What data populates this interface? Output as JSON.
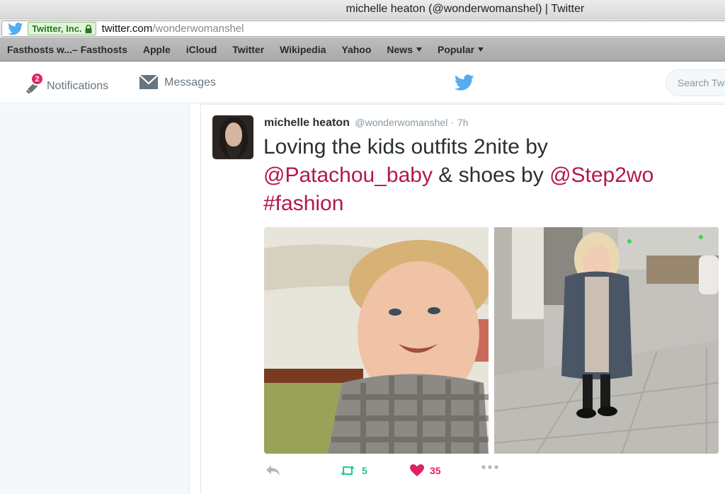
{
  "window": {
    "title": "michelle heaton (@wonderwomanshel) | Twitter"
  },
  "address_bar": {
    "cert_label": "Twitter, Inc.",
    "url_host": "twitter.com",
    "url_path": "/wonderwomanshel"
  },
  "bookmarks": [
    {
      "label": "Fasthosts w...– Fasthosts",
      "has_menu": false
    },
    {
      "label": "Apple",
      "has_menu": false
    },
    {
      "label": "iCloud",
      "has_menu": false
    },
    {
      "label": "Twitter",
      "has_menu": false
    },
    {
      "label": "Wikipedia",
      "has_menu": false
    },
    {
      "label": "Yahoo",
      "has_menu": false
    },
    {
      "label": "News",
      "has_menu": true
    },
    {
      "label": "Popular",
      "has_menu": true
    }
  ],
  "nav": {
    "notifications_label": "Notifications",
    "notifications_count": "2",
    "messages_label": "Messages",
    "search_placeholder": "Search Twitter"
  },
  "tweet": {
    "name": "michelle heaton",
    "handle": "@wonderwomanshel",
    "separator": "·",
    "time": "7h",
    "text_part1": "Loving the kids outfits 2nite by ",
    "mention1": "@Patachou_baby",
    "text_part2": " & shoes by ",
    "mention2": "@Step2wo",
    "hashtag": "#fashion",
    "retweet_count": "5",
    "like_count": "35"
  },
  "colors": {
    "twitter_blue": "#55acee",
    "link": "#b3174d",
    "retweet": "#19cf86",
    "like": "#e0245e",
    "secondary_text": "#8899a6"
  },
  "icons": [
    "twitter-bird-icon",
    "lock-icon",
    "bell-icon",
    "mail-icon",
    "reply-icon",
    "retweet-icon",
    "heart-icon",
    "more-icon",
    "caret-down-icon"
  ]
}
